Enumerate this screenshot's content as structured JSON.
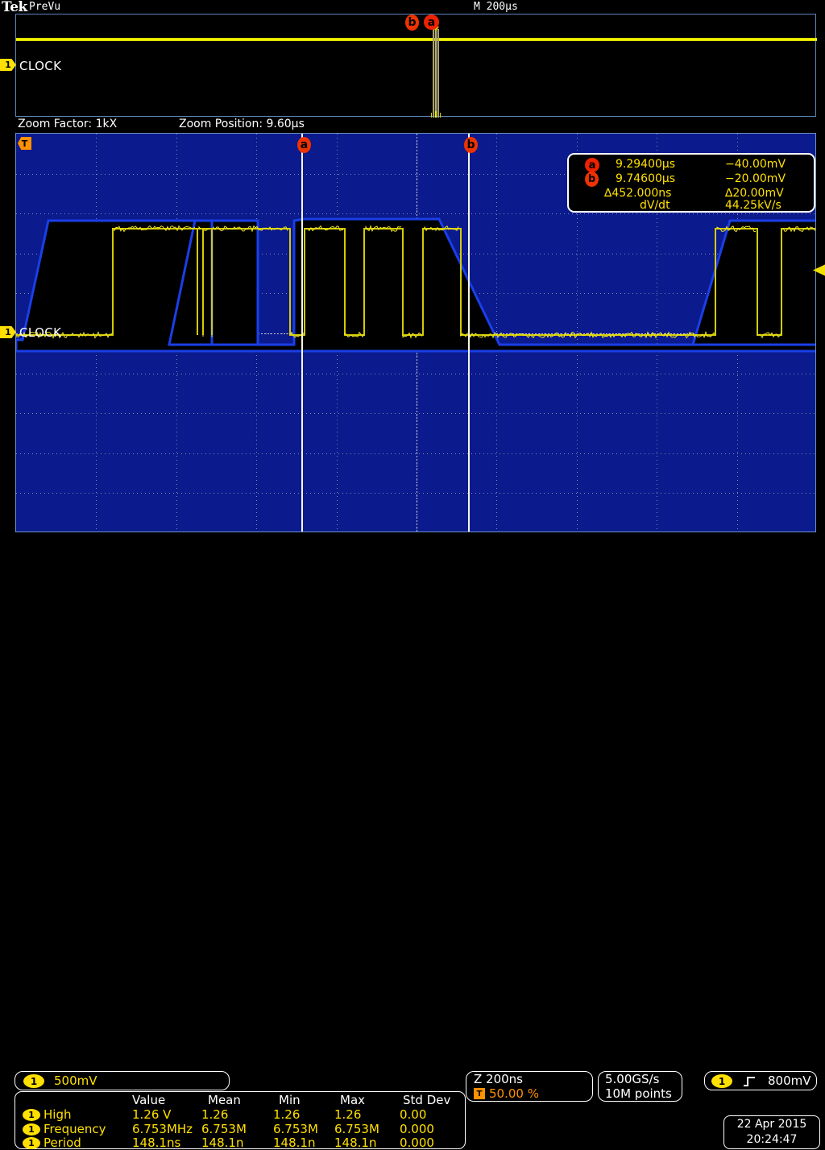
{
  "header": {
    "brand": "Tek",
    "acq_state": "PreVu",
    "timebase": "M 200µs"
  },
  "main_graticule": {
    "channel_badge": "1",
    "channel_label": "CLOCK",
    "zoom_marker_a": "a",
    "zoom_marker_b": "b"
  },
  "zoom_info": {
    "factor_label": "Zoom Factor: 1kX",
    "position_label": "Zoom Position: 9.60µs"
  },
  "zoom_graticule": {
    "channel_badge": "1",
    "channel_label": "CLOCK",
    "trigger_badge": "T",
    "cursor_a_badge": "a",
    "cursor_b_badge": "b"
  },
  "cursor_readout": {
    "rows": [
      {
        "badge": "a",
        "time": "9.29400µs",
        "volt": "−40.00mV"
      },
      {
        "badge": "b",
        "time": "9.74600µs",
        "volt": "−20.00mV"
      },
      {
        "badge": "",
        "time": "∆452.000ns",
        "volt": "∆20.00mV"
      },
      {
        "badge": "",
        "time": "dV/dt",
        "volt": "44.25kV/s"
      }
    ]
  },
  "status_bar": {
    "channel_badge": "1",
    "channel_scale": "500mV",
    "zoom_timebase": "Z 200ns",
    "trigger_badge": "T",
    "trigger_position": "50.00 %",
    "sample_rate": "5.00GS/s",
    "record_length": "10M points",
    "trigger_channel_badge": "1",
    "trigger_slope_icon": "rising-edge-icon",
    "trigger_level": "800mV"
  },
  "measurements": {
    "columns": [
      "Value",
      "Mean",
      "Min",
      "Max",
      "Std Dev"
    ],
    "rows": [
      {
        "badge": "1",
        "name": "High",
        "value": "1.26 V",
        "mean": "1.26",
        "min": "1.26",
        "max": "1.26",
        "stddev": "0.00"
      },
      {
        "badge": "1",
        "name": "Frequency",
        "value": "6.753MHz",
        "mean": "6.753M",
        "min": "6.753M",
        "max": "6.753M",
        "stddev": "0.000"
      },
      {
        "badge": "1",
        "name": "Period",
        "value": "148.1ns",
        "mean": "148.1n",
        "min": "148.1n",
        "max": "148.1n",
        "stddev": "0.000"
      }
    ]
  },
  "datetime": {
    "date": "22 Apr 2015",
    "time": "20:24:47"
  },
  "colors": {
    "channel1": "#ffe000",
    "graticule_bg": "#0b1a8c",
    "cursor_badge": "#ee2200",
    "trigger": "#ff9000"
  }
}
